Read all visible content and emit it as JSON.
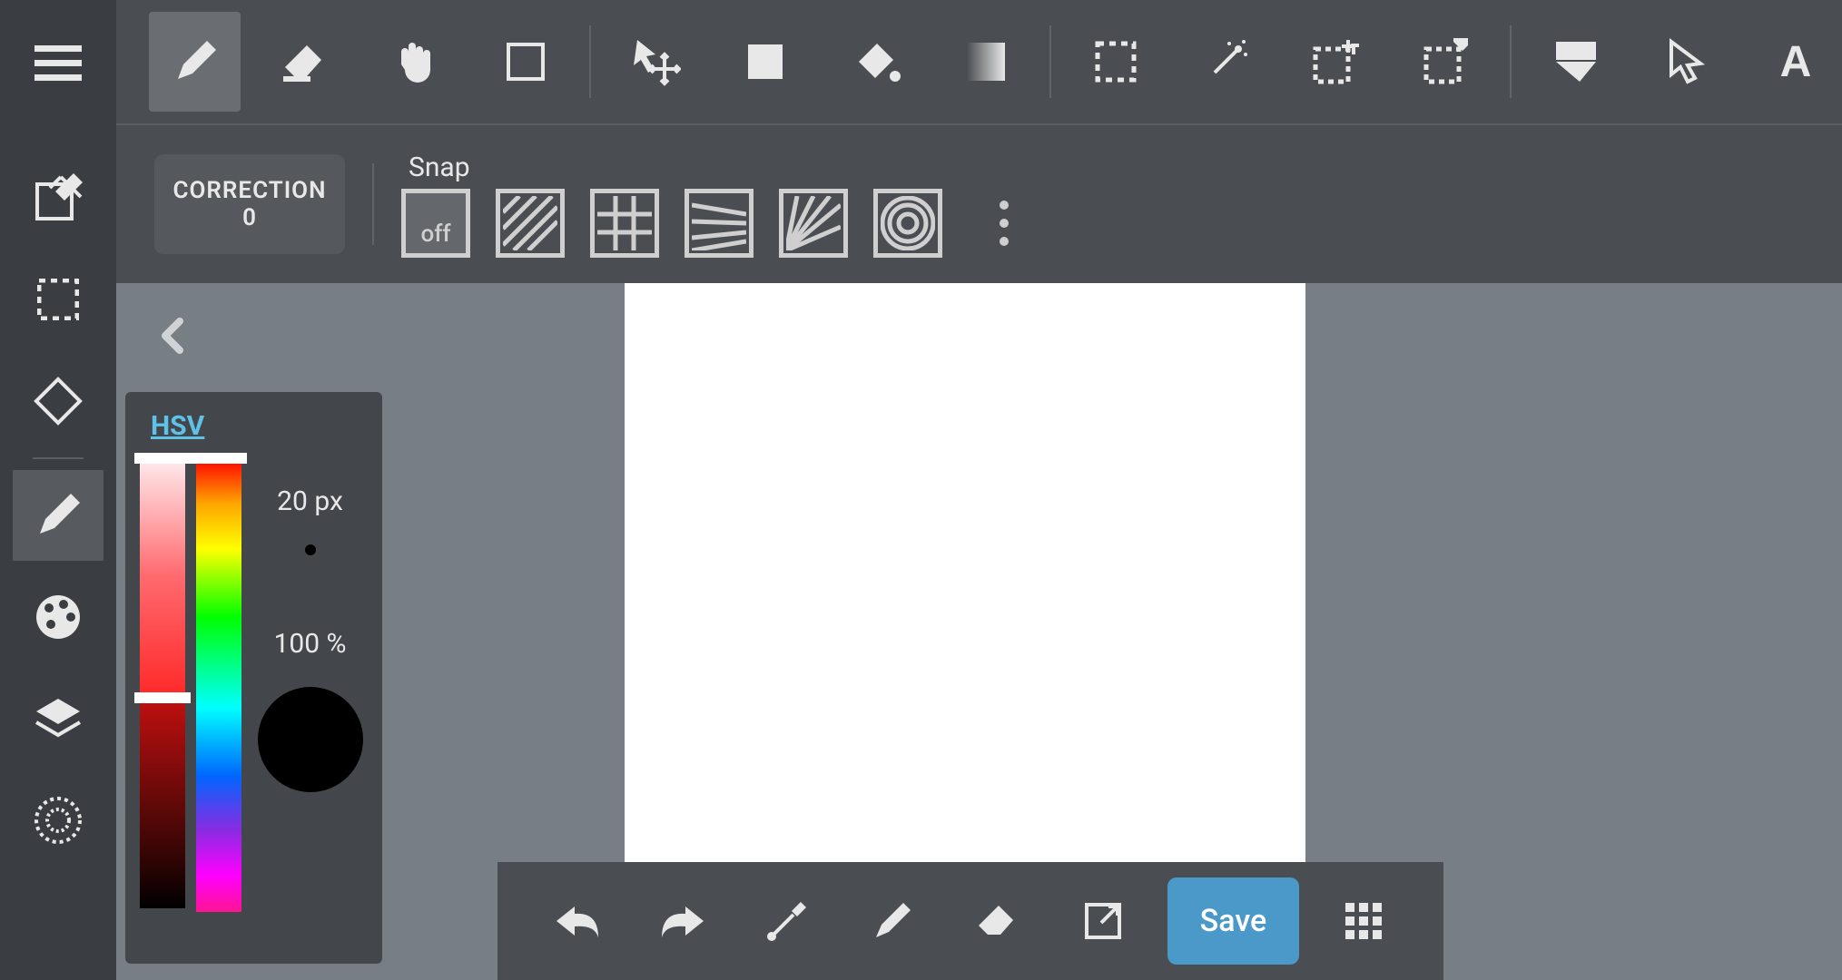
{
  "left_rail": {
    "items": [
      "menu",
      "edit",
      "select",
      "rotate",
      "brush",
      "palette",
      "layers",
      "material"
    ]
  },
  "toolbar": {
    "tools": [
      "pencil",
      "eraser",
      "hand",
      "shape",
      "transform",
      "fill-rect",
      "bucket",
      "gradient",
      "marquee",
      "magic-wand",
      "select-add",
      "select-subtract",
      "crop",
      "pointer",
      "text"
    ],
    "active": "pencil"
  },
  "correction": {
    "label": "CORRECTION",
    "value": "0"
  },
  "snap": {
    "label": "Snap",
    "modes": [
      "off",
      "hatch",
      "grid",
      "perspective",
      "radial",
      "concentric"
    ],
    "active": "off"
  },
  "color_panel": {
    "mode_label": "HSV",
    "brush_size": "20 px",
    "opacity": "100 %",
    "current_color": "#000000"
  },
  "bottom_bar": {
    "actions": [
      "undo",
      "redo",
      "eyedropper",
      "pencil",
      "eraser",
      "fullscreen",
      "save",
      "apps"
    ],
    "save_label": "Save"
  },
  "canvas": {
    "bg": "#ffffff"
  }
}
